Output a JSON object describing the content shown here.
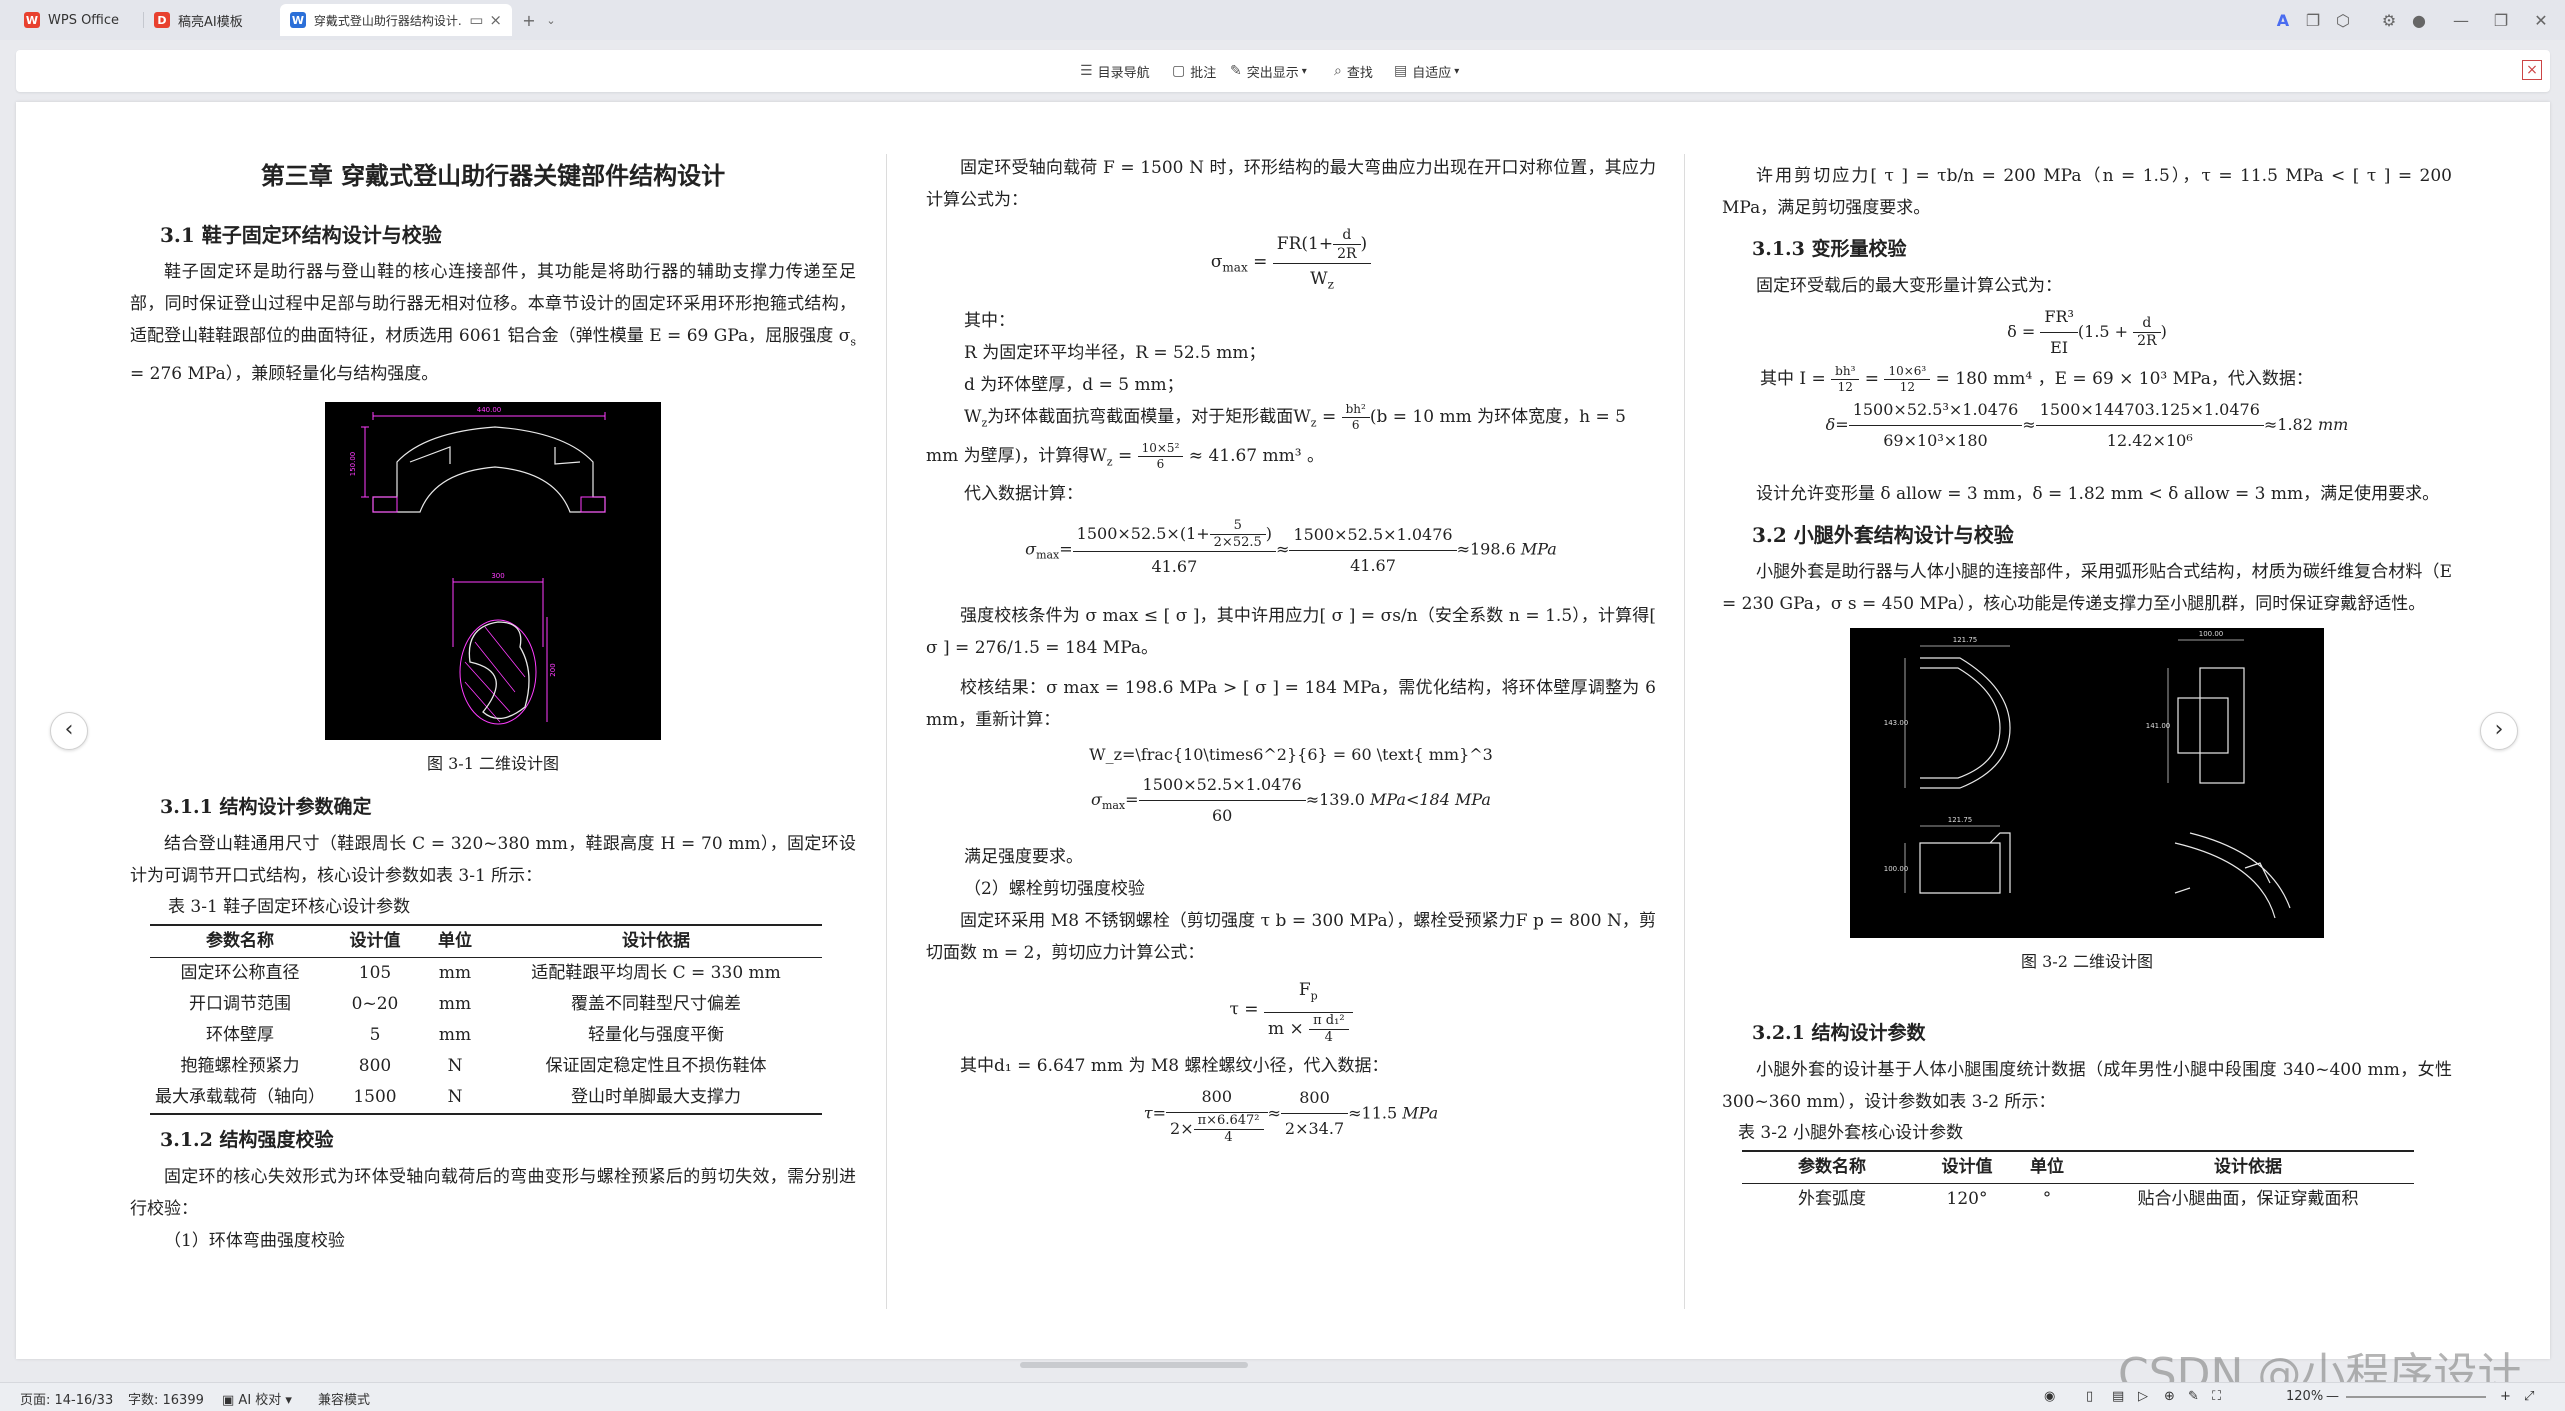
{
  "tabs": [
    {
      "label": "WPS Office",
      "icon": "W",
      "color": "#e8412f"
    },
    {
      "label": "稿亮AI模板",
      "icon": "D",
      "color": "#e8412f"
    },
    {
      "label": "穿戴式登山助行器结构设计...",
      "icon": "W",
      "color": "#2b6fd8"
    }
  ],
  "toolbar": {
    "nav_label": "目录导航",
    "comment_label": "批注",
    "highlight_label": "突出显示",
    "find_label": "查找",
    "fit_label": "自适应"
  },
  "col1": {
    "chapter": "第三章  穿戴式登山助行器关键部件结构设计",
    "s31": "3.1  鞋子固定环结构设计与校验",
    "p1": "鞋子固定环是助行器与登山鞋的核心连接部件，其功能是将助行器的辅助支撑力传递至足部，同时保证登山过程中足部与助行器无相对位移。本章节设计的固定环采用环形抱箍式结构，适配登山鞋鞋跟部位的曲面特征，材质选用 6061 铝合金（弹性模量 E = 69 GPa，屈服强度 σ",
    "p1_sub": "s",
    "p1_end": " = 276 MPa），兼顾轻量化与结构强度。",
    "fig1_caption": "图 3-1  二维设计图",
    "s311": "3.1.1  结构设计参数确定",
    "p2": "结合登山鞋通用尺寸（鞋跟周长 C = 320~380 mm，鞋跟高度 H = 70 mm），固定环设计为可调节开口式结构，核心设计参数如表 3-1 所示：",
    "table_caption": "表 3-1  鞋子固定环核心设计参数",
    "table_head": [
      "参数名称",
      "设计值",
      "单位",
      "设计依据"
    ],
    "table_rows": [
      [
        "固定环公称直径",
        "105",
        "mm",
        "适配鞋跟平均周长 C = 330 mm"
      ],
      [
        "开口调节范围",
        "0~20",
        "mm",
        "覆盖不同鞋型尺寸偏差"
      ],
      [
        "环体壁厚",
        "5",
        "mm",
        "轻量化与强度平衡"
      ],
      [
        "抱箍螺栓预紧力",
        "800",
        "N",
        "保证固定稳定性且不损伤鞋体"
      ],
      [
        "最大承载载荷（轴向）",
        "1500",
        "N",
        "登山时单脚最大支撑力"
      ]
    ],
    "s312": "3.1.2  结构强度校验",
    "p3": "固定环的核心失效形式为环体受轴向载荷后的弯曲变形与螺栓预紧后的剪切失效，需分别进行校验：",
    "p4": "（1）环体弯曲强度校验"
  },
  "col2": {
    "p1": "固定环受轴向载荷 F = 1500 N 时，环形结构的最大弯曲应力出现在开口对称位置，其应力计算公式为：",
    "f1_lhs": "σ",
    "f1_lhs_sub": "max",
    "f1_num": "FR(1+",
    "f1_num_frac_n": "d",
    "f1_num_frac_d": "2R",
    "f1_num_end": ")",
    "f1_den": "W",
    "f1_den_sub": "z",
    "where": "其中：",
    "l1": "R 为固定环平均半径，R = 52.5 mm；",
    "l2": "d 为环体壁厚，d = 5 mm；",
    "l3": "W",
    "l3_sub": "z",
    "l3_rest": "为环体截面抗弯截面模量，对于矩形截面W",
    "l3_sub2": "z",
    "l3_eq": " = ",
    "l3_frac_n": "bh²",
    "l3_frac_d": "6",
    "l3_tail": "(b = 10 mm 为环体宽度，h = 5",
    "l4": "mm 为壁厚)，计算得W",
    "l4_sub": "z",
    "l4_eq": " = ",
    "l4_frac_n": "10×5²",
    "l4_frac_d": "6",
    "l4_tail": " ≈ 41.67 mm³ 。",
    "l5": "代入数据计算：",
    "f2_lhs": "σ",
    "f2_sub": "max",
    "f2_n1": "1500×52.5×(1+",
    "f2_n1f_n": "5",
    "f2_n1f_d": "2×52.5",
    "f2_n1e": ")",
    "f2_d1": "41.67",
    "f2_n2": "1500×52.5×1.0476",
    "f2_d2": "41.67",
    "f2_res": "≈198.6",
    "f2_unit": "MPa",
    "p2": "强度校核条件为 σ max ≤ [ σ ]，其中许用应力[ σ ] = σs/n（安全系数 n = 1.5），计算得[ σ ] = 276/1.5 = 184 MPa。",
    "p3": "校核结果：σ max = 198.6 MPa > [ σ ] = 184 MPa，需优化结构，将环体壁厚调整为 6 mm，重新计算：",
    "wz": "W_z=\\frac{10\\times6^2}{6} = 60  \\text{ mm}^3",
    "f3_lhs": "σ",
    "f3_sub": "max",
    "f3_n": "1500×52.5×1.0476",
    "f3_d": "60",
    "f3_res": "≈139.0",
    "f3_unit": "MPa<184 MPa",
    "ok": "满足强度要求。",
    "bolt": "（2）螺栓剪切强度校验",
    "p4": "固定环采用 M8 不锈钢螺栓（剪切强度 τ b = 300 MPa），螺栓受预紧力F p = 800 N，剪切面数 m = 2，剪切应力计算公式：",
    "f4_lhs": "τ",
    "f4_n": "F",
    "f4_n_sub": "p",
    "f4_d": "m × ",
    "f4_d_frac_n": "π d₁²",
    "f4_d_frac_d": "4",
    "p5": "其中d₁ = 6.647 mm 为 M8 螺栓螺纹小径，代入数据：",
    "f5_lhs": "τ=",
    "f5_n": "800",
    "f5_d_pre": "2×",
    "f5_d_frac_n": "π×6.647²",
    "f5_d_frac_d": "4",
    "f5_n2": "800",
    "f5_d2": "2×34.7",
    "f5_res": "≈11.5",
    "f5_unit": "MPa"
  },
  "col3": {
    "p1": "许用剪切应力[ τ ] = τb/n = 200 MPa（n = 1.5），τ = 11.5 MPa < [ τ ] = 200 MPa，满足剪切强度要求。",
    "s313": "3.1.3  变形量校验",
    "p2": "固定环受载后的最大变形量计算公式为：",
    "f1_lhs": "δ = ",
    "f1_n": "FR³",
    "f1_d": "EI",
    "f1_tail": "(1.5 + ",
    "f1_tf_n": "d",
    "f1_tf_d": "2R",
    "f1_end": ")",
    "p3_a": "其中 I = ",
    "p3_f1n": "bh³",
    "p3_f1d": "12",
    "p3_b": " = ",
    "p3_f2n": "10×6³",
    "p3_f2d": "12",
    "p3_c": " = 180 mm⁴ ，E = 69 × 10³ MPa，代入数据：",
    "f2_lhs": "δ=",
    "f2_n1": "1500×52.5³×1.0476",
    "f2_d1": "69×10³×180",
    "f2_n2": "1500×144703.125×1.0476",
    "f2_d2": "12.42×10⁶",
    "f2_res": "≈1.82",
    "f2_unit": "mm",
    "p4": "设计允许变形量 δ allow = 3 mm，δ = 1.82 mm < δ allow = 3 mm，满足使用要求。",
    "s32": "3.2  小腿外套结构设计与校验",
    "p5": "小腿外套是助行器与人体小腿的连接部件，采用弧形贴合式结构，材质为碳纤维复合材料（E = 230 GPa，σ s = 450 MPa），核心功能是传递支撑力至小腿肌群，同时保证穿戴舒适性。",
    "fig2_caption": "图 3-2 二维设计图",
    "dims": [
      "121.75",
      "100.00",
      "143.00",
      "141.00",
      "121.75",
      "100.00"
    ],
    "s321": "3.2.1  结构设计参数",
    "p6": "小腿外套的设计基于人体小腿围度统计数据（成年男性小腿中段围度 340~400 mm，女性 300~360 mm），设计参数如表 3-2 所示：",
    "table_caption": "表 3-2  小腿外套核心设计参数",
    "table_head": [
      "参数名称",
      "设计值",
      "单位",
      "设计依据"
    ],
    "table_rows": [
      [
        "外套弧度",
        "120°",
        "°",
        "贴合小腿曲面，保证穿戴面积"
      ]
    ]
  },
  "fig1_dims": [
    "440.00",
    "150.00",
    "300",
    "200"
  ],
  "status": {
    "page": "页面: 14-16/33",
    "words": "字数: 16399",
    "ai": "AI 校对",
    "mode": "兼容模式",
    "zoom": "120%"
  },
  "watermark": "CSDN @小程序设计"
}
